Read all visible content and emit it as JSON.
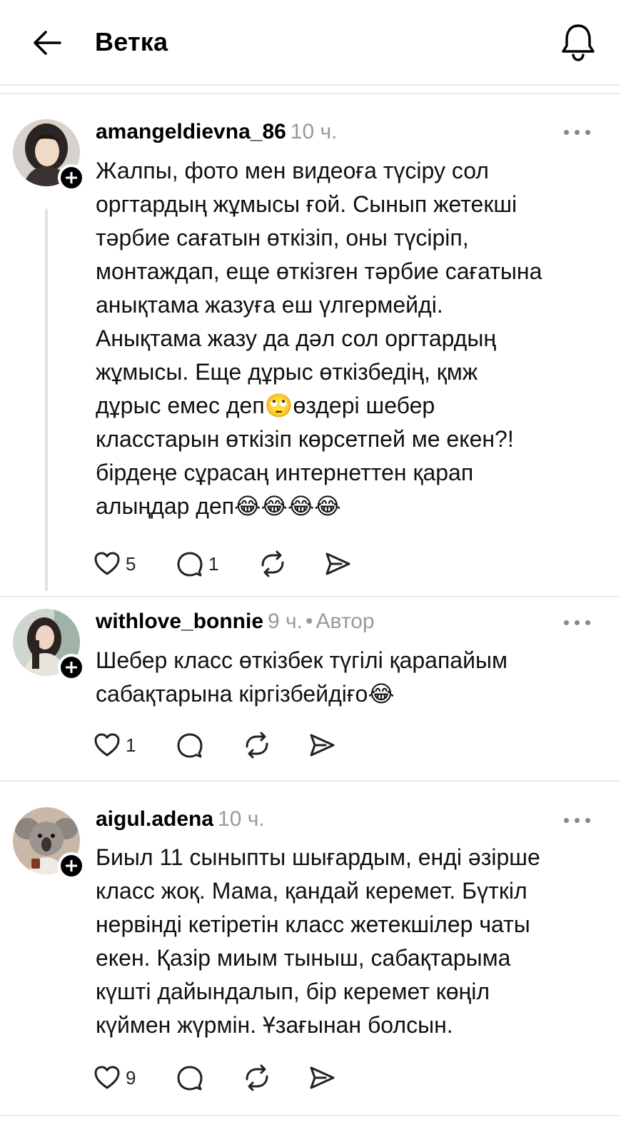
{
  "header": {
    "title": "Ветка"
  },
  "comments": [
    {
      "username": "amangeldievna_86",
      "time": "10 ч.",
      "author_tag": "",
      "text": "Жалпы, фото мен видеоға түсіру сол\nоргтардың жұмысы ғой. Сынып жетекші\nтәрбие сағатын өткізіп, оны түсіріп,\nмонтаждап, еще өткізген тәрбие сағатына\nанықтама жазуға еш үлгермейді.\nАнықтама жазу да дәл сол оргтардың\nжұмысы. Еще дұрыс өткізбедің, қмж\nдұрыс емес деп🙄өздері шебер\nкласстарын өткізіп көрсетпей ме екен?!\nбірдеңе сұрасаң интернеттен қарап\nалыңдар деп😂😂😂😂",
      "likes": "5",
      "replies": "1"
    },
    {
      "username": "withlove_bonnie",
      "time": "9 ч.",
      "separator": "•",
      "author_tag": "Автор",
      "text": "Шебер класс өткізбек түгілі қарапайым\nсабақтарына кіргізбейдіғо😂",
      "likes": "1",
      "replies": ""
    },
    {
      "username": "aigul.adena",
      "time": "10 ч.",
      "author_tag": "",
      "text": "Биыл 11 сыныпты шығардым, енді әзірше\nкласс жоқ. Мама, қандай керемет. Бүткіл\nнервінді кетіретін класс жетекшілер чаты\nекен. Қазір миым тыныш, сабақтарыма\nкүшті дайындалып, бір керемет көңіл\nкүймен жүрмін. Ұзағынан болсын.",
      "likes": "9",
      "replies": ""
    }
  ],
  "icons": {
    "back": "arrow-left-icon",
    "notifications": "bell-icon",
    "more": "more-horizontal-icon",
    "like": "heart-icon",
    "reply": "comment-icon",
    "repost": "repost-icon",
    "share": "send-icon",
    "follow": "plus-icon"
  },
  "colors": {
    "text": "#000000",
    "muted": "#999999",
    "divider": "#ececec",
    "badge": "#000000"
  }
}
